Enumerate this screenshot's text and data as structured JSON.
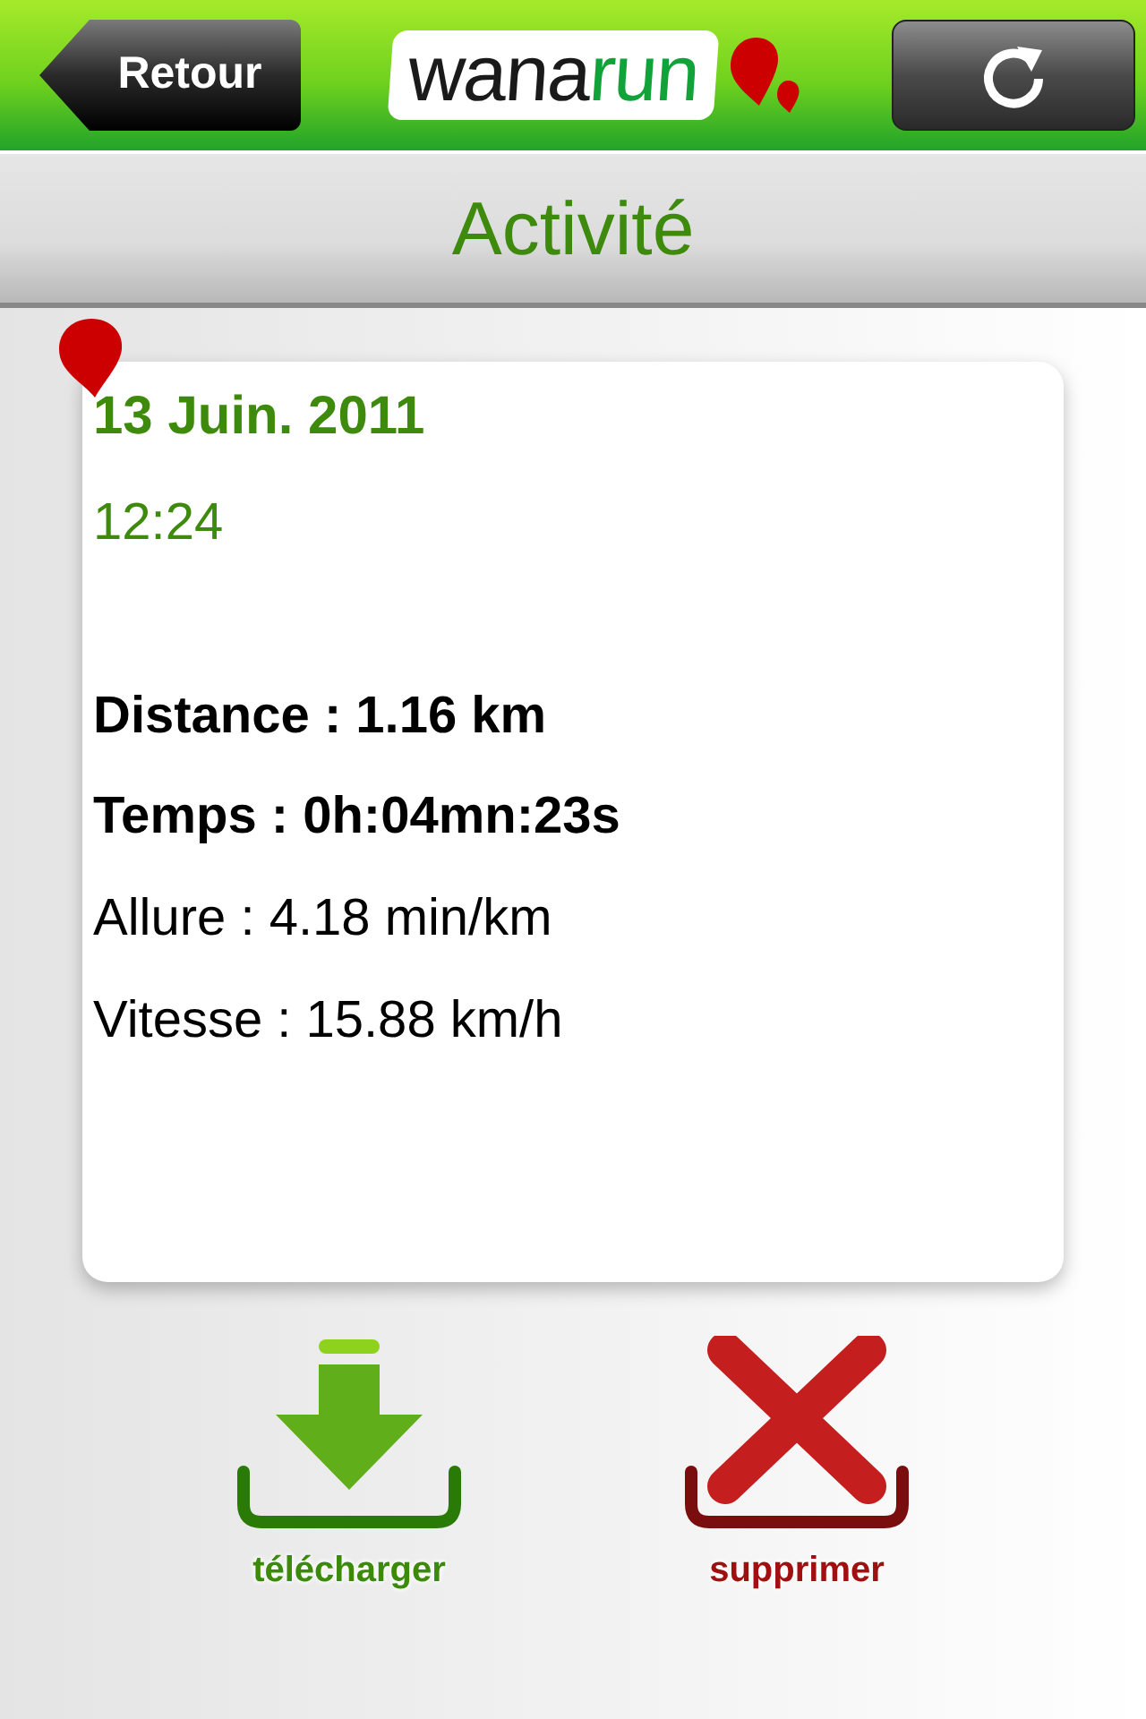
{
  "header": {
    "back_button": "Retour",
    "logo": {
      "dark_part": "wana",
      "green_part": "run"
    }
  },
  "title": "Activité",
  "activity": {
    "date": "13 Juin. 2011",
    "time": "12:24",
    "stats": [
      {
        "text": "Distance : 1.16 km",
        "emphasized": true
      },
      {
        "text": "Temps : 0h:04mn:23s",
        "emphasized": true
      },
      {
        "text": "Allure : 4.18 min/km",
        "emphasized": false
      },
      {
        "text": "Vitesse : 15.88 km/h",
        "emphasized": false
      }
    ]
  },
  "actions": [
    {
      "kind": "download",
      "label": "télécharger"
    },
    {
      "kind": "delete",
      "label": "supprimer"
    }
  ]
}
